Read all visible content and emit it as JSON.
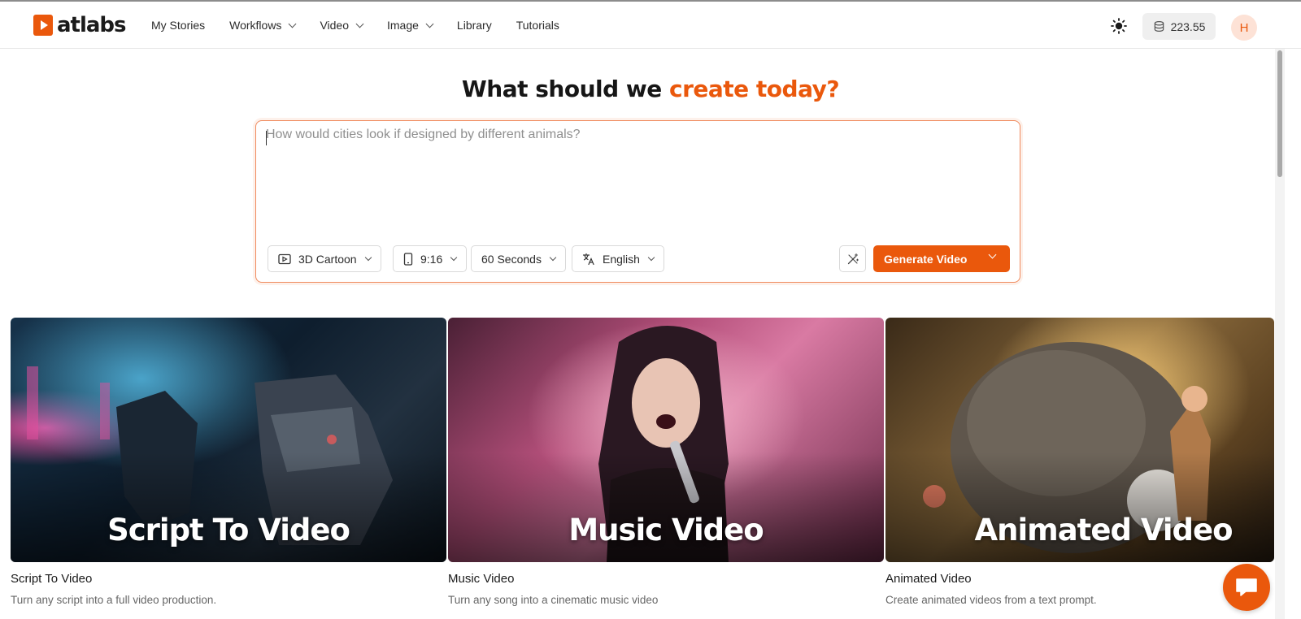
{
  "app": {
    "logo_text": "atlabs",
    "colors": {
      "accent": "#ea580c",
      "accent_soft": "#fde2d6"
    }
  },
  "nav": {
    "items": [
      {
        "label": "My Stories",
        "dropdown": false
      },
      {
        "label": "Workflows",
        "dropdown": true
      },
      {
        "label": "Video",
        "dropdown": true
      },
      {
        "label": "Image",
        "dropdown": true
      },
      {
        "label": "Library",
        "dropdown": false
      },
      {
        "label": "Tutorials",
        "dropdown": false
      }
    ],
    "theme_icon": "sun-icon",
    "credits_icon": "coins-icon",
    "credits": "223.55",
    "avatar_initial": "H"
  },
  "hero": {
    "title_main": "What should we ",
    "title_accent": "create today?",
    "prompt_placeholder": "How would cities look if designed by different animals?",
    "prompt_value": ""
  },
  "options": {
    "style": {
      "label": "3D Cartoon",
      "icon": "video-style-icon"
    },
    "aspect": {
      "label": "9:16",
      "icon": "phone-icon"
    },
    "duration": {
      "label": "60 Seconds"
    },
    "language": {
      "label": "English",
      "icon": "translate-icon"
    },
    "enhance_icon": "magic-wand-icon",
    "generate_label": "Generate Video"
  },
  "cards": [
    {
      "image_text": "Script To Video",
      "title": "Script To Video",
      "description": "Turn any script into a full video production."
    },
    {
      "image_text": "Music Video",
      "title": "Music Video",
      "description": "Turn any song into a cinematic music video"
    },
    {
      "image_text": "Animated Video",
      "title": "Animated Video",
      "description": "Create animated videos from a text prompt."
    }
  ],
  "chat_icon": "chat-bubble-icon"
}
